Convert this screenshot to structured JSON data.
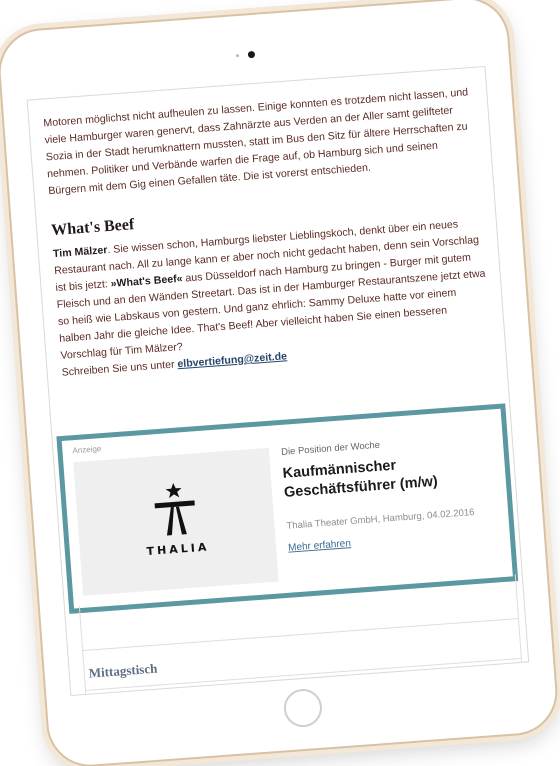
{
  "article": {
    "intro_paragraph": "Motoren möglichst nicht aufheulen zu lassen. Einige konnten es trotzdem nicht lassen, und viele Hamburger waren genervt, dass Zahnärzte aus Verden an der Aller samt gelifteter Sozia in der Stadt herumknattern mussten, statt im Bus den Sitz für ältere Herrschaften zu nehmen. Politiker und Verbände warfen die Frage auf, ob Hamburg sich und seinen Bürgern mit dem Gig einen Gefallen täte. Die ist vorerst entschieden.",
    "section_title": "What's Beef",
    "p2_name": "Tim Mälzer",
    "p2_text_a": ". Sie wissen schon, Hamburgs liebster Lieblingskoch, denkt über ein neues Restaurant nach. All zu lange kann er aber noch nicht gedacht haben, denn sein Vorschlag ist bis jetzt: ",
    "p2_bold": "»What's Beef«",
    "p2_text_b": " aus Düsseldorf nach Hamburg zu bringen - Burger mit gutem Fleisch und an den Wänden Streetart. Das ist in der Hamburger Restaurantszene jetzt etwa so heiß wie Labskaus von gestern. Und ganz ehrlich: Sammy Deluxe hatte vor einem halben Jahr die gleiche Idee. That's Beef! Aber vielleicht haben Sie einen besseren Vorschlag für Tim Mälzer?",
    "p2_cta": "Schreiben Sie uns unter ",
    "email_link": "elbvertiefung@zeit.de"
  },
  "ad": {
    "label": "Anzeige",
    "kicker": "Die Position der Woche",
    "title": "Kaufmännischer Geschäftsführer (m/w)",
    "meta": "Thalia Theater GmbH, Hamburg, 04.02.2016",
    "link": "Mehr erfahren",
    "logo_text": "THALIA",
    "logo_icon": "thalia-star-figure-icon",
    "highlight_color": "#5b98a2"
  },
  "next_section": {
    "title": "Mittagstisch"
  }
}
